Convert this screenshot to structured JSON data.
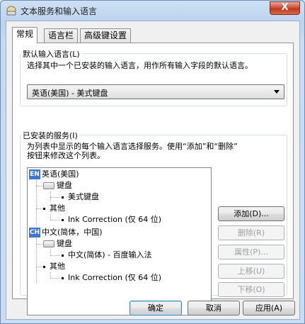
{
  "window": {
    "title": "文本服务和输入语言",
    "close_glyph": "X"
  },
  "tabs": [
    {
      "label": "常规",
      "active": true
    },
    {
      "label": "语言栏",
      "active": false
    },
    {
      "label": "高级键设置",
      "active": false
    }
  ],
  "default_lang": {
    "group_label": "默认输入语言(L)",
    "description": "选择其中一个已安装的输入语言，用作所有输入字段的默认语言。",
    "selected": "英语(美国) - 美式键盘"
  },
  "services": {
    "group_label": "已安装的服务(I)",
    "description_line1": "为列表中显示的每个输入语言选择服务。使用“添加”和“删除”",
    "description_line2": "按钮来修改这个列表。",
    "tree": {
      "lang1_badge": "EN",
      "lang1_name": "英语(美国)",
      "lang1_cat1": "键盘",
      "lang1_item1": "美式键盘",
      "lang1_cat2": "其他",
      "lang1_item2": "Ink Correction (仅 64 位)",
      "lang2_badge": "CH",
      "lang2_name": "中文(简体，中国)",
      "lang2_cat1": "键盘",
      "lang2_item1": "中文(简体) - 百度输入法",
      "lang2_cat2": "其他",
      "lang2_item2": "Ink Correction (仅 64 位)"
    },
    "buttons": {
      "add": "添加(D)...",
      "remove": "删除(R)",
      "properties": "属性(P)...",
      "move_up": "上移(U)",
      "move_down": "下移(O)"
    }
  },
  "footer": {
    "ok": "确定",
    "cancel": "取消",
    "apply": "应用(A)"
  },
  "colors": {
    "badge_blue": "#3d78d8",
    "close_red": "#c0361c"
  }
}
